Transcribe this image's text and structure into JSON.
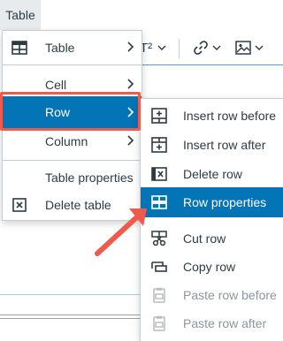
{
  "menubar": {
    "table_label": "Table"
  },
  "toolbar": {
    "superscript_label": "T²"
  },
  "main_menu": {
    "items": [
      {
        "label": "Table",
        "icon": "table-icon"
      },
      {
        "label": "Cell"
      },
      {
        "label": "Row"
      },
      {
        "label": "Column"
      },
      {
        "label": "Table properties"
      },
      {
        "label": "Delete table",
        "icon": "delete-table-icon"
      }
    ]
  },
  "row_submenu": {
    "items": [
      {
        "label": "Insert row before",
        "icon": "insert-row-before-icon"
      },
      {
        "label": "Insert row after",
        "icon": "insert-row-after-icon"
      },
      {
        "label": "Delete row",
        "icon": "delete-row-icon"
      },
      {
        "label": "Row properties",
        "icon": "row-properties-icon"
      },
      {
        "label": "Cut row",
        "icon": "cut-row-icon"
      },
      {
        "label": "Copy row",
        "icon": "copy-row-icon"
      },
      {
        "label": "Paste row before",
        "icon": "paste-row-before-icon",
        "disabled": true
      },
      {
        "label": "Paste row after",
        "icon": "paste-row-after-icon",
        "disabled": true
      }
    ]
  },
  "colors": {
    "highlight": "#0374b5",
    "callout": "#f05a4a",
    "text": "#2d3b45",
    "disabled_text": "#8b969e"
  }
}
